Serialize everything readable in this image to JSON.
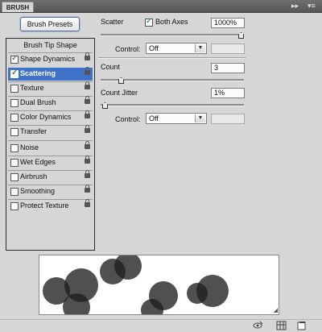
{
  "window": {
    "tab_label": "BRUSH",
    "collapse_glyph": "▸▸",
    "menu_glyph": "▾≡"
  },
  "brush_presets_button": "Brush Presets",
  "left_list": {
    "header": "Brush Tip Shape",
    "items": [
      {
        "label": "Shape Dynamics",
        "checked": true,
        "selected": false
      },
      {
        "label": "Scattering",
        "checked": true,
        "selected": true
      },
      {
        "label": "Texture",
        "checked": false,
        "selected": false
      },
      {
        "label": "Dual Brush",
        "checked": false,
        "selected": false
      },
      {
        "label": "Color Dynamics",
        "checked": false,
        "selected": false
      },
      {
        "label": "Transfer",
        "checked": false,
        "selected": false
      },
      {
        "label": "Noise",
        "checked": false,
        "selected": false
      },
      {
        "label": "Wet Edges",
        "checked": false,
        "selected": false
      },
      {
        "label": "Airbrush",
        "checked": false,
        "selected": false
      },
      {
        "label": "Smoothing",
        "checked": false,
        "selected": false
      },
      {
        "label": "Protect Texture",
        "checked": false,
        "selected": false
      }
    ],
    "check_glyph": "✓"
  },
  "scatter": {
    "label": "Scatter",
    "both_axes_label": "Both Axes",
    "both_axes_checked": true,
    "value": "1000%",
    "slider_fraction": 1.0,
    "control_label": "Control:",
    "control_value": "Off"
  },
  "count": {
    "label": "Count",
    "value": "3",
    "slider_fraction": 0.13
  },
  "count_jitter": {
    "label": "Count Jitter",
    "value": "1%",
    "slider_fraction": 0.01,
    "control_label": "Control:",
    "control_value": "Off"
  },
  "colors": {
    "selection": "#3f73c9",
    "brush_dab": "#1f1f1f"
  },
  "bottom_toolbar": {
    "icons": [
      "eye-brush-icon",
      "grid-icon",
      "new-preset-icon"
    ]
  }
}
